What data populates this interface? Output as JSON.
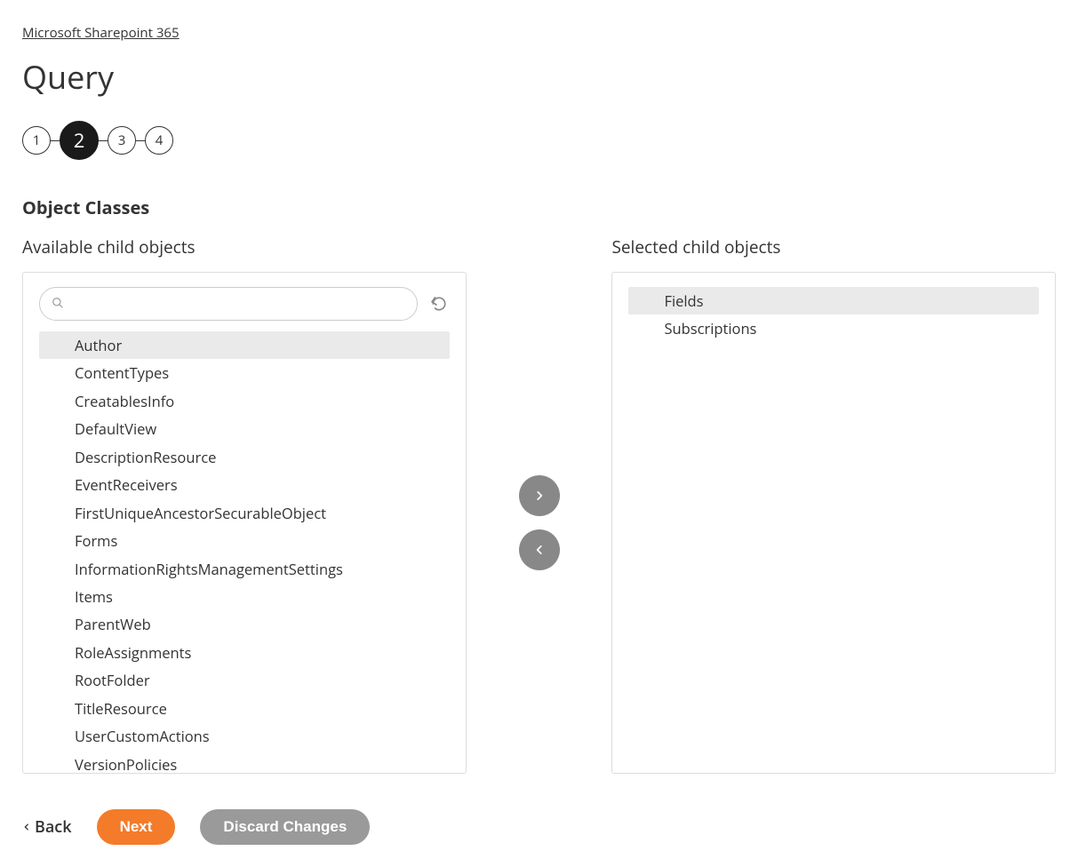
{
  "breadcrumb": "Microsoft Sharepoint 365",
  "page_title": "Query",
  "stepper": {
    "steps": [
      "1",
      "2",
      "3",
      "4"
    ],
    "active_index": 1
  },
  "section_title": "Object Classes",
  "available": {
    "header": "Available child objects",
    "search_placeholder": "",
    "items": [
      "Author",
      "ContentTypes",
      "CreatablesInfo",
      "DefaultView",
      "DescriptionResource",
      "EventReceivers",
      "FirstUniqueAncestorSecurableObject",
      "Forms",
      "InformationRightsManagementSettings",
      "Items",
      "ParentWeb",
      "RoleAssignments",
      "RootFolder",
      "TitleResource",
      "UserCustomActions",
      "VersionPolicies"
    ],
    "highlighted_index": 0
  },
  "selected": {
    "header": "Selected child objects",
    "items": [
      "Fields",
      "Subscriptions"
    ],
    "highlighted_index": 0
  },
  "footer": {
    "back": "Back",
    "next": "Next",
    "discard": "Discard Changes"
  }
}
